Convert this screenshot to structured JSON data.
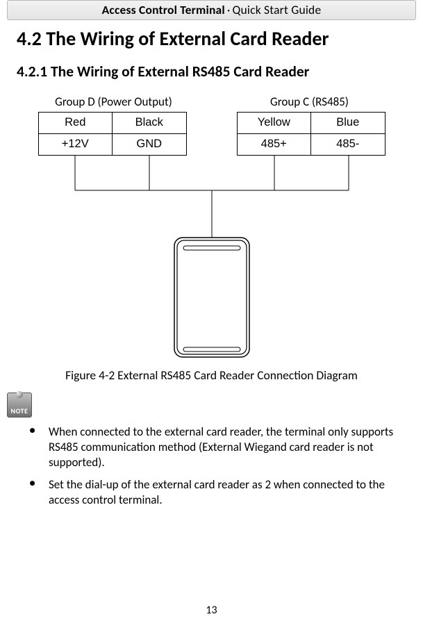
{
  "header": {
    "bold": "Access Control Terminal",
    "sep": "·",
    "rest": "Quick Start Guide"
  },
  "h1": "4.2 The Wiring of External Card Reader",
  "h2": "4.2.1 The Wiring of External RS485 Card Reader",
  "diagram": {
    "groupD_label": "Group D (Power Output)",
    "groupC_label": "Group C (RS485)",
    "groupD": {
      "row1": {
        "c1": "Red",
        "c2": "Black"
      },
      "row2": {
        "c1": "+12V",
        "c2": "GND"
      }
    },
    "groupC": {
      "row1": {
        "c1": "Yellow",
        "c2": "Blue"
      },
      "row2": {
        "c1": "485+",
        "c2": "485-"
      }
    }
  },
  "caption": "Figure 4-2  External RS485 Card Reader Connection Diagram",
  "noteIcon": "NOTE",
  "notes": {
    "n1": "When connected to the external card reader, the terminal only supports RS485 communication method (External Wiegand card reader is not supported).",
    "n2": "Set the dial-up of the external card reader as 2 when connected to the access control terminal."
  },
  "pageNumber": "13"
}
